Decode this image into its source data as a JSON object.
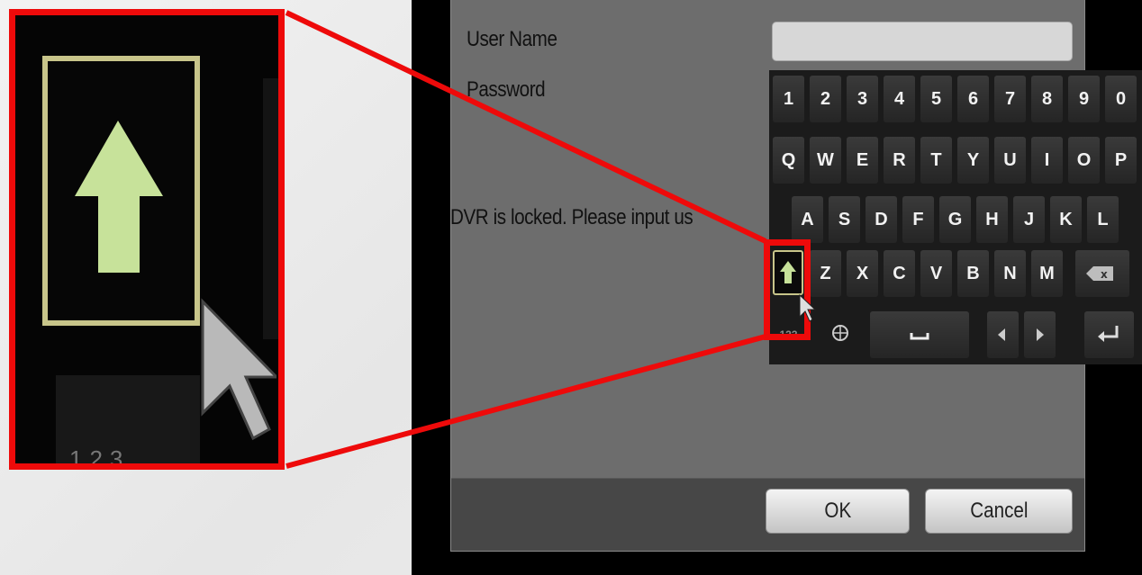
{
  "dialog": {
    "username_label": "User Name",
    "password_label": "Password",
    "status_message": "DVR is locked. Please input us",
    "username_value": "",
    "ok_label": "OK",
    "cancel_label": "Cancel"
  },
  "keyboard": {
    "row1": [
      "1",
      "2",
      "3",
      "4",
      "5",
      "6",
      "7",
      "8",
      "9",
      "0"
    ],
    "row2": [
      "Q",
      "W",
      "E",
      "R",
      "T",
      "Y",
      "U",
      "I",
      "O",
      "P"
    ],
    "row3": [
      "A",
      "S",
      "D",
      "F",
      "G",
      "H",
      "J",
      "K",
      "L"
    ],
    "row4": [
      "Z",
      "X",
      "C",
      "V",
      "B",
      "N",
      "M"
    ],
    "mode_label": "123",
    "icons": {
      "shift": "shift-up-arrow-icon",
      "backspace": "backspace-icon",
      "globe": "globe-icon",
      "space": "space-bar-icon",
      "left": "left-arrow-icon",
      "right": "right-arrow-icon",
      "enter": "enter-icon",
      "cursor": "mouse-pointer-icon"
    }
  },
  "callout": {
    "zoom_label": "123",
    "highlight_color": "#ee0a0a",
    "shift_arrow_color": "#c7e29a",
    "shift_frame_color": "#c8c58a"
  }
}
